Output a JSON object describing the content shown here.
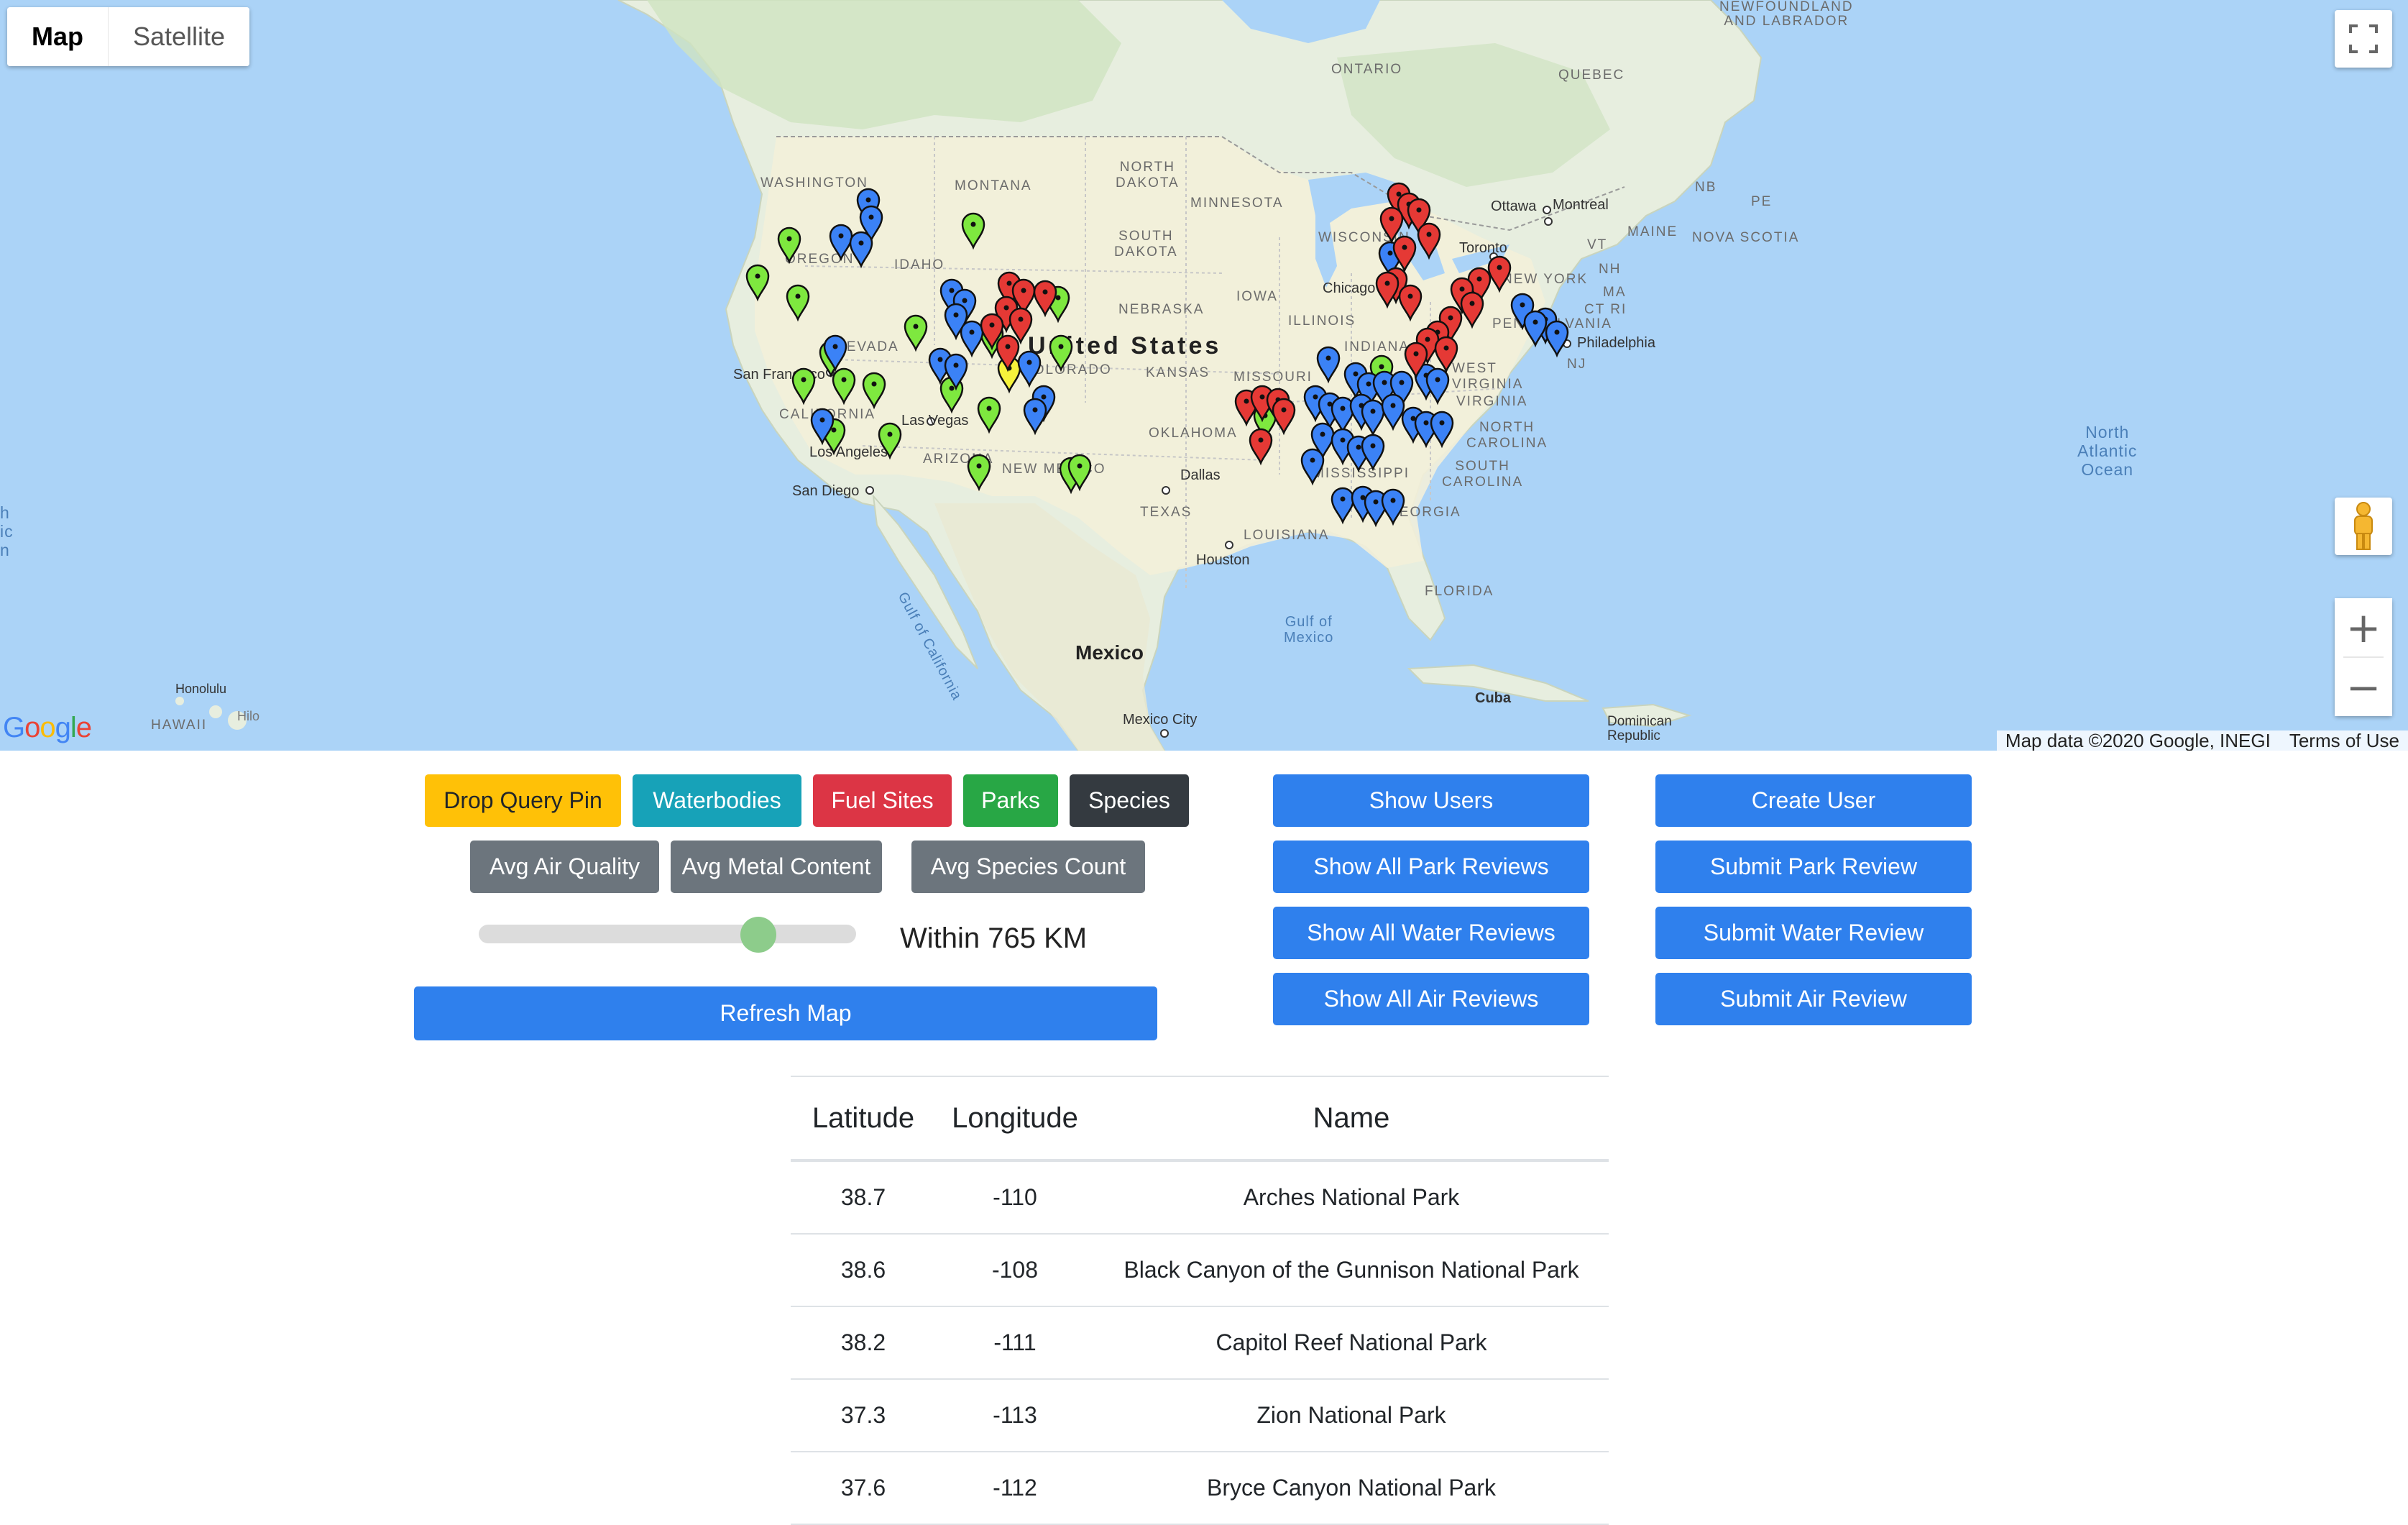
{
  "map": {
    "maptype_buttons": [
      "Map",
      "Satellite"
    ],
    "labels": {
      "ontario": "ONTARIO",
      "quebec": "QUEBEC",
      "newfoundland": "NEWFOUNDLAND\nAND LABRADOR",
      "washington": "WASHINGTON",
      "montana": "MONTANA",
      "north_dakota": "NORTH\nDAKOTA",
      "minnesota": "MINNESOTA",
      "south_dakota": "SOUTH\nDAKOTA",
      "wisconsin": "WISCONSIN",
      "idaho": "IDAHO",
      "oregon": "OREGON",
      "nebraska": "NEBRASKA",
      "iowa": "IOWA",
      "illinois": "ILLINOIS",
      "indiana": "INDIANA",
      "nevada": "NEVADA",
      "kansas": "KANSAS",
      "missouri": "MISSOURI",
      "colorado": "COLORADO",
      "oklahoma": "OKLAHOMA",
      "arizona": "ARIZONA",
      "new_mexico": "NEW MEXICO",
      "texas": "TEXAS",
      "louisiana": "LOUISIANA",
      "mississippi": "MISSISSIPPI",
      "georgia": "GEORGIA",
      "florida": "FLORIDA",
      "virginia": "VIRGINIA",
      "west_virginia": "WEST\nVIRGINIA",
      "north_carolina": "NORTH\nCAROLINA",
      "south_carolina": "SOUTH\nCAROLINA",
      "new_york": "NEW YORK",
      "pennsylvania": "PENNSYLVANIA",
      "maine": "MAINE",
      "nova_scotia": "NOVA SCOTIA",
      "nb": "NB",
      "pe": "PE",
      "vt": "VT",
      "nh": "NH",
      "ma": "MA",
      "ct_ri": "CT RI",
      "nj": "NJ",
      "california": "CALIFORNIA",
      "united_states": "United States",
      "mexico": "Mexico",
      "cuba": "Cuba",
      "dominican_republic": "Dominican\nRepublic",
      "ottawa": "Ottawa",
      "montreal": "Montreal",
      "toronto": "Toronto",
      "chicago": "Chicago",
      "philadelphia": "Philadelphia",
      "san_francisco": "San Francisco",
      "las_vegas": "Las Vegas",
      "los_angeles": "Los Angeles",
      "san_diego": "San Diego",
      "dallas": "Dallas",
      "houston": "Houston",
      "mexico_city": "Mexico City",
      "honolulu": "Honolulu",
      "hawaii": "HAWAII",
      "hilo": "Hilo",
      "gulf_of_mexico": "Gulf of\nMexico",
      "gulf_of_california": "Gulf of California",
      "north_atlantic": "North\nAtlantic\nOcean",
      "north_pacific_partial": "h\nic\nn"
    },
    "google_logo": "Google",
    "attribution_data": "Map data ©2020 Google, INEGI",
    "attribution_terms": "Terms of Use",
    "zoom_in": "+",
    "zoom_out": "−",
    "fullscreen_icon": "fullscreen-icon",
    "pegman_icon": "street-view-pegman-icon",
    "marker_colors": {
      "blue": "#3b82f6",
      "red": "#e53935",
      "green": "#7ee83f",
      "yellow": "#f6f33b"
    }
  },
  "controls": {
    "filter_buttons": {
      "drop_pin": "Drop Query Pin",
      "waterbodies": "Waterbodies",
      "fuel_sites": "Fuel Sites",
      "parks": "Parks",
      "species": "Species"
    },
    "avg_buttons": {
      "air_quality": "Avg Air Quality",
      "metal_content": "Avg Metal Content",
      "species_count": "Avg Species Count"
    },
    "slider": {
      "label": "Within 765 KM",
      "value_fraction": 0.74
    },
    "refresh": "Refresh Map"
  },
  "user_actions": {
    "show_users": "Show Users",
    "show_park_reviews": "Show All Park Reviews",
    "show_water_reviews": "Show All Water Reviews",
    "show_air_reviews": "Show All Air Reviews",
    "create_user": "Create User",
    "submit_park_review": "Submit Park Review",
    "submit_water_review": "Submit Water Review",
    "submit_air_review": "Submit Air Review"
  },
  "table": {
    "headers": [
      "Latitude",
      "Longitude",
      "Name"
    ],
    "rows": [
      [
        "38.7",
        "-110",
        "Arches National Park"
      ],
      [
        "38.6",
        "-108",
        "Black Canyon of the Gunnison National Park"
      ],
      [
        "38.2",
        "-111",
        "Capitol Reef National Park"
      ],
      [
        "37.3",
        "-113",
        "Zion National Park"
      ],
      [
        "37.6",
        "-112",
        "Bryce Canyon National Park"
      ]
    ]
  }
}
